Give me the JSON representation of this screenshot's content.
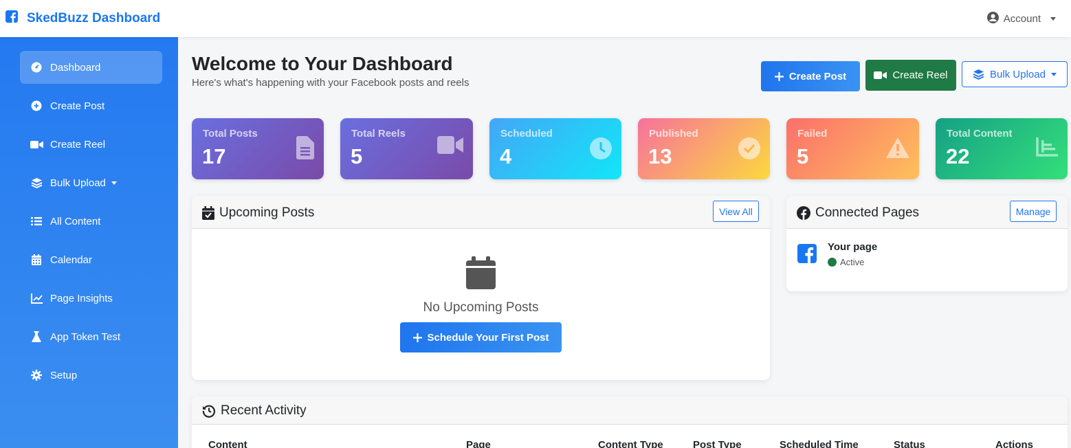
{
  "app": {
    "title": "SkedBuzz Dashboard",
    "account_label": "Account"
  },
  "sidebar": {
    "items": [
      {
        "label": "Dashboard",
        "icon": "gauge-icon",
        "active": true
      },
      {
        "label": "Create Post",
        "icon": "plus-circle-icon"
      },
      {
        "label": "Create Reel",
        "icon": "video-icon"
      },
      {
        "label": "Bulk Upload",
        "icon": "layers-icon",
        "has_dropdown": true
      },
      {
        "label": "All Content",
        "icon": "list-icon"
      },
      {
        "label": "Calendar",
        "icon": "calendar-icon"
      },
      {
        "label": "Page Insights",
        "icon": "line-chart-icon"
      },
      {
        "label": "App Token Test",
        "icon": "flask-icon"
      },
      {
        "label": "Setup",
        "icon": "gear-icon"
      }
    ]
  },
  "header": {
    "title": "Welcome to Your Dashboard",
    "subtitle": "Here's what's happening with your Facebook posts and reels",
    "buttons": {
      "create_post": "Create Post",
      "create_reel": "Create Reel",
      "bulk_upload": "Bulk Upload"
    }
  },
  "stats": [
    {
      "label": "Total Posts",
      "value": "17",
      "icon": "file-icon"
    },
    {
      "label": "Total Reels",
      "value": "5",
      "icon": "video-icon"
    },
    {
      "label": "Scheduled",
      "value": "4",
      "icon": "clock-icon"
    },
    {
      "label": "Published",
      "value": "13",
      "icon": "check-circle-icon"
    },
    {
      "label": "Failed",
      "value": "5",
      "icon": "warning-icon"
    },
    {
      "label": "Total Content",
      "value": "22",
      "icon": "bar-chart-icon"
    }
  ],
  "upcoming": {
    "title": "Upcoming Posts",
    "view_all": "View All",
    "empty_title": "No Upcoming Posts",
    "schedule_button": "Schedule Your First Post"
  },
  "connected": {
    "title": "Connected Pages",
    "manage": "Manage",
    "pages": [
      {
        "name": "Your page",
        "status": "Active"
      }
    ]
  },
  "recent": {
    "title": "Recent Activity",
    "columns": [
      "Content",
      "Page",
      "Content Type",
      "Post Type",
      "Scheduled Time",
      "Status",
      "Actions"
    ]
  },
  "colors": {
    "brand": "#1877f2",
    "sidebar": "#2479f0",
    "success": "#1f7a45"
  }
}
